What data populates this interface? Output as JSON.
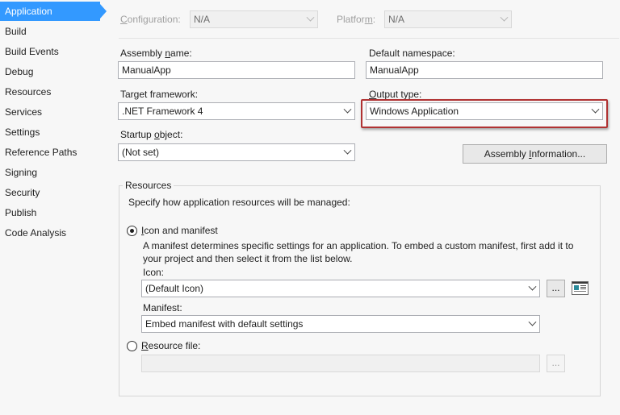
{
  "sidebar": {
    "items": [
      {
        "label": "Application"
      },
      {
        "label": "Build"
      },
      {
        "label": "Build Events"
      },
      {
        "label": "Debug"
      },
      {
        "label": "Resources"
      },
      {
        "label": "Services"
      },
      {
        "label": "Settings"
      },
      {
        "label": "Reference Paths"
      },
      {
        "label": "Signing"
      },
      {
        "label": "Security"
      },
      {
        "label": "Publish"
      },
      {
        "label": "Code Analysis"
      }
    ],
    "active_index": 0
  },
  "toolbar": {
    "configuration": {
      "label_pre": "",
      "label_mnemonic": "C",
      "label_post": "onfiguration:",
      "value": "N/A"
    },
    "platform": {
      "label_pre": "Platfor",
      "label_mnemonic": "m",
      "label_post": ":",
      "value": "N/A"
    }
  },
  "form": {
    "assembly_name": {
      "label_pre": "Assembly ",
      "label_mnemonic": "n",
      "label_post": "ame:",
      "value": "ManualApp"
    },
    "default_namespace": {
      "label": "Default namespace:",
      "value": "ManualApp"
    },
    "target_framework": {
      "label_pre": "Tar",
      "label_mnemonic": "g",
      "label_post": "et framework:",
      "value": ".NET Framework 4"
    },
    "output_type": {
      "label_pre": "",
      "label_mnemonic": "O",
      "label_post": "utput type:",
      "value": "Windows Application"
    },
    "startup_object": {
      "label_pre": "Startup ",
      "label_mnemonic": "o",
      "label_post": "bject:",
      "value": "(Not set)"
    },
    "assembly_info_button": {
      "label_pre": "Assembly ",
      "label_mnemonic": "I",
      "label_post": "nformation..."
    }
  },
  "resources": {
    "group_title": "Resources",
    "description": "Specify how application resources will be managed:",
    "icon_and_manifest": {
      "label_pre": "",
      "label_mnemonic": "I",
      "label_post": "con and manifest",
      "selected": true
    },
    "manifest_help_line1": "A manifest determines specific settings for an application. To embed a custom manifest, first add it to",
    "manifest_help_line2": "your project and then select it from the list below.",
    "icon": {
      "label": "Icon:",
      "value": "(Default Icon)"
    },
    "browse_label": "...",
    "manifest": {
      "label": "Manifest:",
      "value": "Embed manifest with default settings"
    },
    "resource_file": {
      "label_pre": "",
      "label_mnemonic": "R",
      "label_post": "esource file:",
      "selected": false,
      "value": ""
    },
    "resource_browse_label": "..."
  },
  "colors": {
    "accent": "#3399ff",
    "highlight_border": "#b03232"
  }
}
